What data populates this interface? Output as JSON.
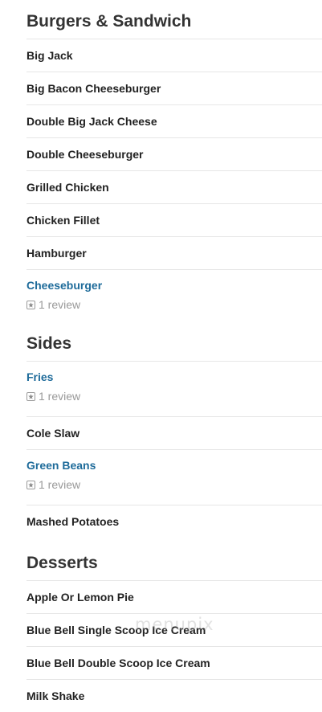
{
  "sections": [
    {
      "title": "Burgers & Sandwich",
      "items": [
        {
          "name": "Big Jack"
        },
        {
          "name": "Big Bacon Cheeseburger"
        },
        {
          "name": "Double Big Jack Cheese"
        },
        {
          "name": "Double Cheeseburger"
        },
        {
          "name": "Grilled Chicken"
        },
        {
          "name": "Chicken Fillet"
        },
        {
          "name": "Hamburger"
        },
        {
          "name": "Cheeseburger",
          "review": "1 review"
        }
      ]
    },
    {
      "title": "Sides",
      "items": [
        {
          "name": "Fries",
          "review": "1 review"
        },
        {
          "name": "Cole Slaw"
        },
        {
          "name": "Green Beans",
          "review": "1 review"
        },
        {
          "name": "Mashed Potatoes"
        }
      ]
    },
    {
      "title": "Desserts",
      "items": [
        {
          "name": "Apple Or Lemon Pie"
        },
        {
          "name": "Blue Bell Single Scoop Ice Cream"
        },
        {
          "name": "Blue Bell Double Scoop Ice Cream"
        },
        {
          "name": "Milk Shake"
        }
      ]
    }
  ],
  "watermark": "menupix",
  "colors": {
    "link": "#1e6b9a",
    "text": "#222222",
    "muted": "#999999",
    "divider": "#e6e6e6"
  },
  "icons": {
    "review": "star-in-box-icon"
  }
}
